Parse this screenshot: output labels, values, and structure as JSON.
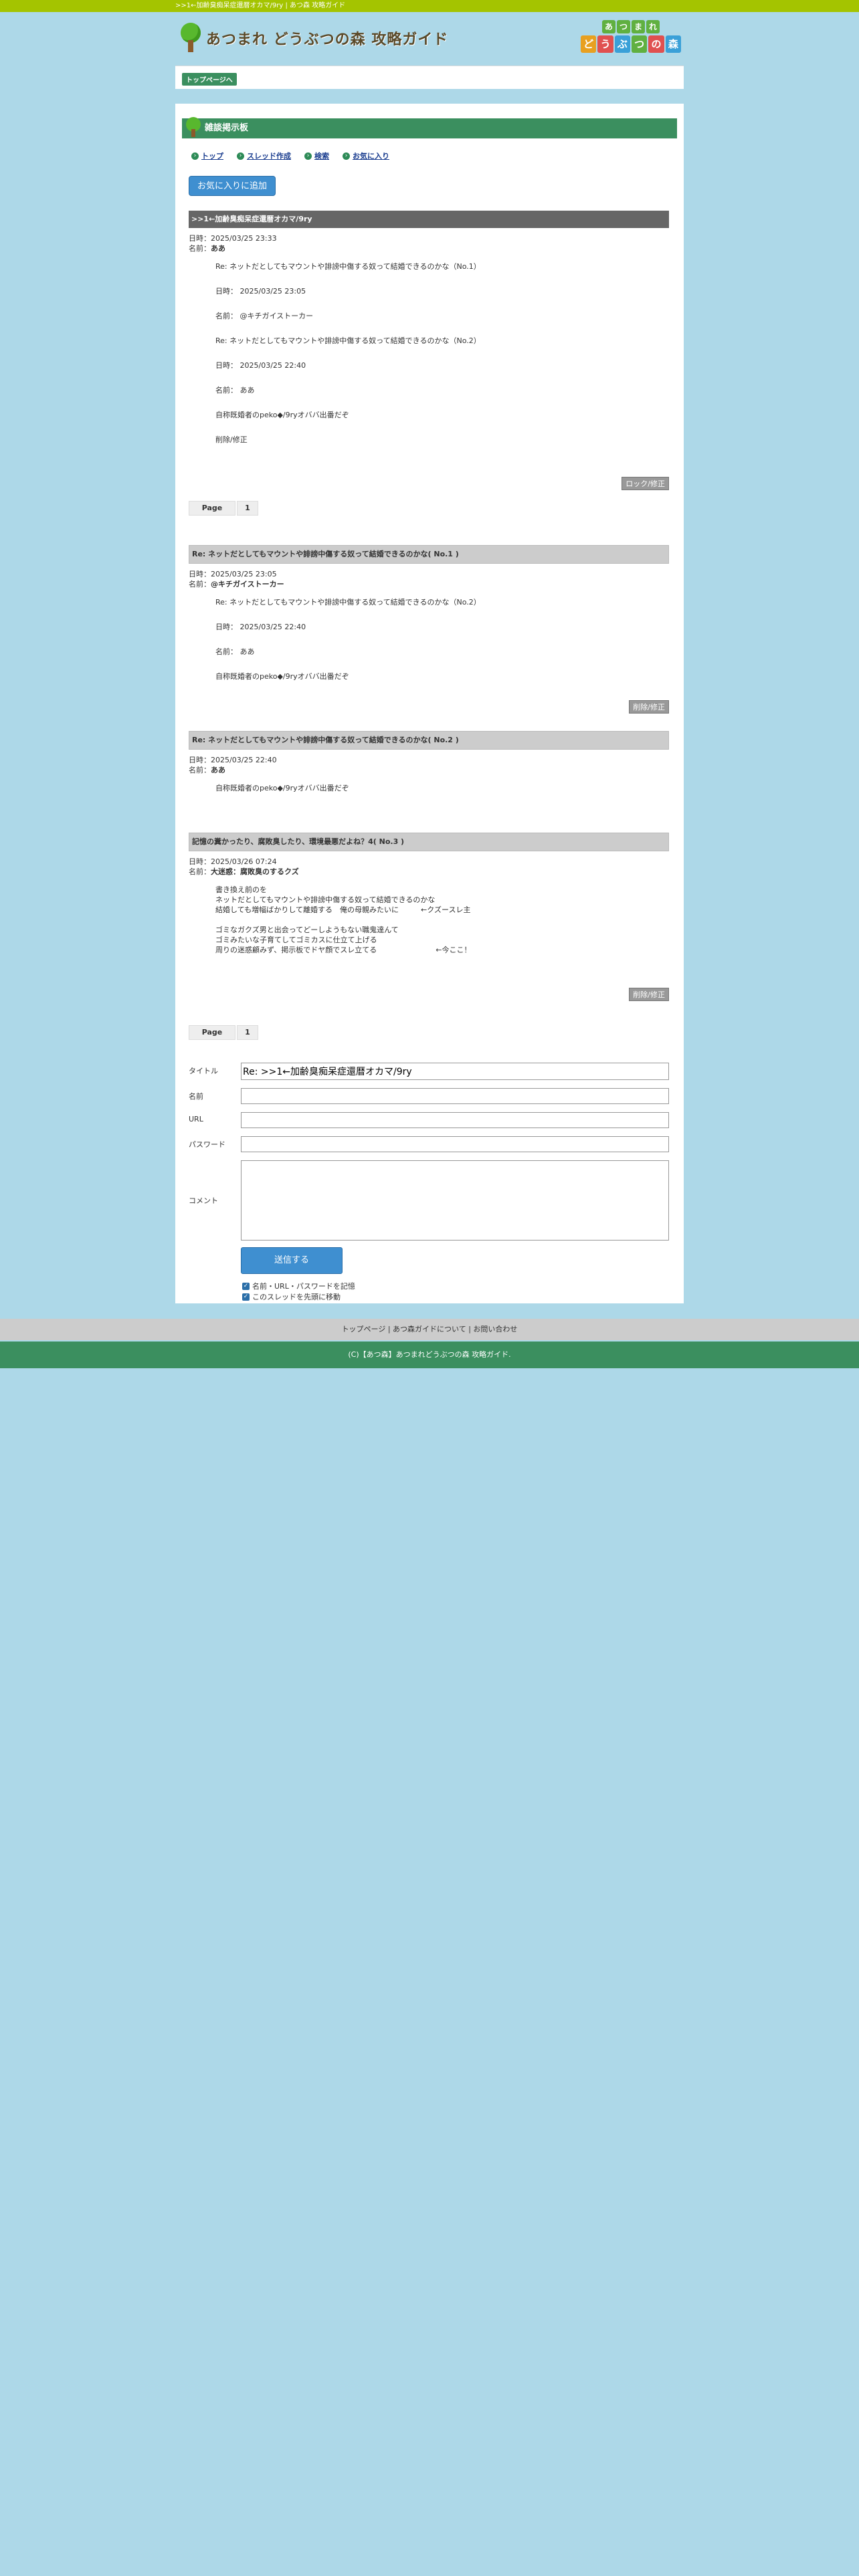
{
  "topbar": {
    "text": ">>1←加齢臭痴呆症還暦オカマ/9ry | あつ森 攻略ガイド"
  },
  "header": {
    "site_title": "あつまれ どうぶつの森 攻略ガイド",
    "logo_row1": [
      "あ",
      "つ",
      "ま",
      "れ"
    ],
    "logo_row2": [
      "ど",
      "う",
      "ぶ",
      "つ",
      "の",
      "森"
    ],
    "logo_colors": [
      "#e8a020",
      "#e05050",
      "#3aa0d8",
      "#60b040",
      "#e05050",
      "#3aa0d8"
    ]
  },
  "nav": {
    "top_label": "トップページへ"
  },
  "board": {
    "title": "雑談掲示板",
    "menu": [
      "トップ",
      "スレッド作成",
      "検索",
      "お気に入り"
    ],
    "fav_button": "お気に入りに追加",
    "lock_button": "ロック/修正",
    "edit_button": "削除/修正"
  },
  "thread": {
    "title": ">>1←加齢臭痴呆症還暦オカマ/9ry",
    "date_label": "日時：",
    "name_label": "名前：",
    "date": "2025/03/25 23:33",
    "name": "ああ",
    "body": [
      "Re: ネットだとしてもマウントや誹謗中傷する奴って結婚できるのかな（No.1）",
      "日時： 2025/03/25 23:05",
      "名前： @キチガイストーカー",
      "Re: ネットだとしてもマウントや誹謗中傷する奴って結婚できるのかな（No.2）",
      "日時： 2025/03/25 22:40",
      "名前： ああ",
      "自称既婚者のpeko◆/9ryオババ出番だぞ",
      "削除/修正"
    ]
  },
  "pager": {
    "label": "Page",
    "page": "1"
  },
  "replies": [
    {
      "title": "Re: ネットだとしてもマウントや誹謗中傷する奴って結婚できるのかな( No.1 )",
      "date": "2025/03/25 23:05",
      "name": "@キチガイストーカー",
      "body": [
        "Re: ネットだとしてもマウントや誹謗中傷する奴って結婚できるのかな（No.2）",
        "日時： 2025/03/25 22:40",
        "名前： ああ",
        "自称既婚者のpeko◆/9ryオババ出番だぞ"
      ]
    },
    {
      "title": "Re: ネットだとしてもマウントや誹謗中傷する奴って結婚できるのかな( No.2 )",
      "date": "2025/03/25 22:40",
      "name": "ああ",
      "body": [
        "自称既婚者のpeko◆/9ryオババ出番だぞ"
      ]
    },
    {
      "title": "記憶の糞かったり、腐敗臭したり、環境最悪だよね？4( No.3 )",
      "date": "2025/03/26 07:24",
      "name": "大迷惑：腐敗臭のするクズ",
      "body": [
        "書き換え前のを",
        "ネットだとしてもマウントや誹謗中傷する奴って結婚できるのかな",
        "結婚しても増幅ばかりして離婚する　俺の母親みたいに　　　←クズースレ主",
        "",
        "ゴミなガクズ男と出会ってどーしようもない職鬼達んて",
        "ゴミみたいな子育てしてゴミカスに仕立て上げる",
        "周りの迷惑顧みず、掲示板でドヤ顔でスレ立てる　　　　　　　　←今ここ！"
      ]
    }
  ],
  "form": {
    "title_label": "タイトル",
    "title_value": "Re: >>1←加齢臭痴呆症還暦オカマ/9ry",
    "name_label": "名前",
    "url_label": "URL",
    "password_label": "パスワード",
    "comment_label": "コメント",
    "submit": "送信する",
    "check1": "名前・URL・パスワードを記憶",
    "check2": "このスレッドを先頭に移動"
  },
  "footer": {
    "links": "トップページ | あつ森ガイドについて | お問い合わせ",
    "copyright": "(C)【あつ森】あつまれどうぶつの森 攻略ガイド."
  }
}
